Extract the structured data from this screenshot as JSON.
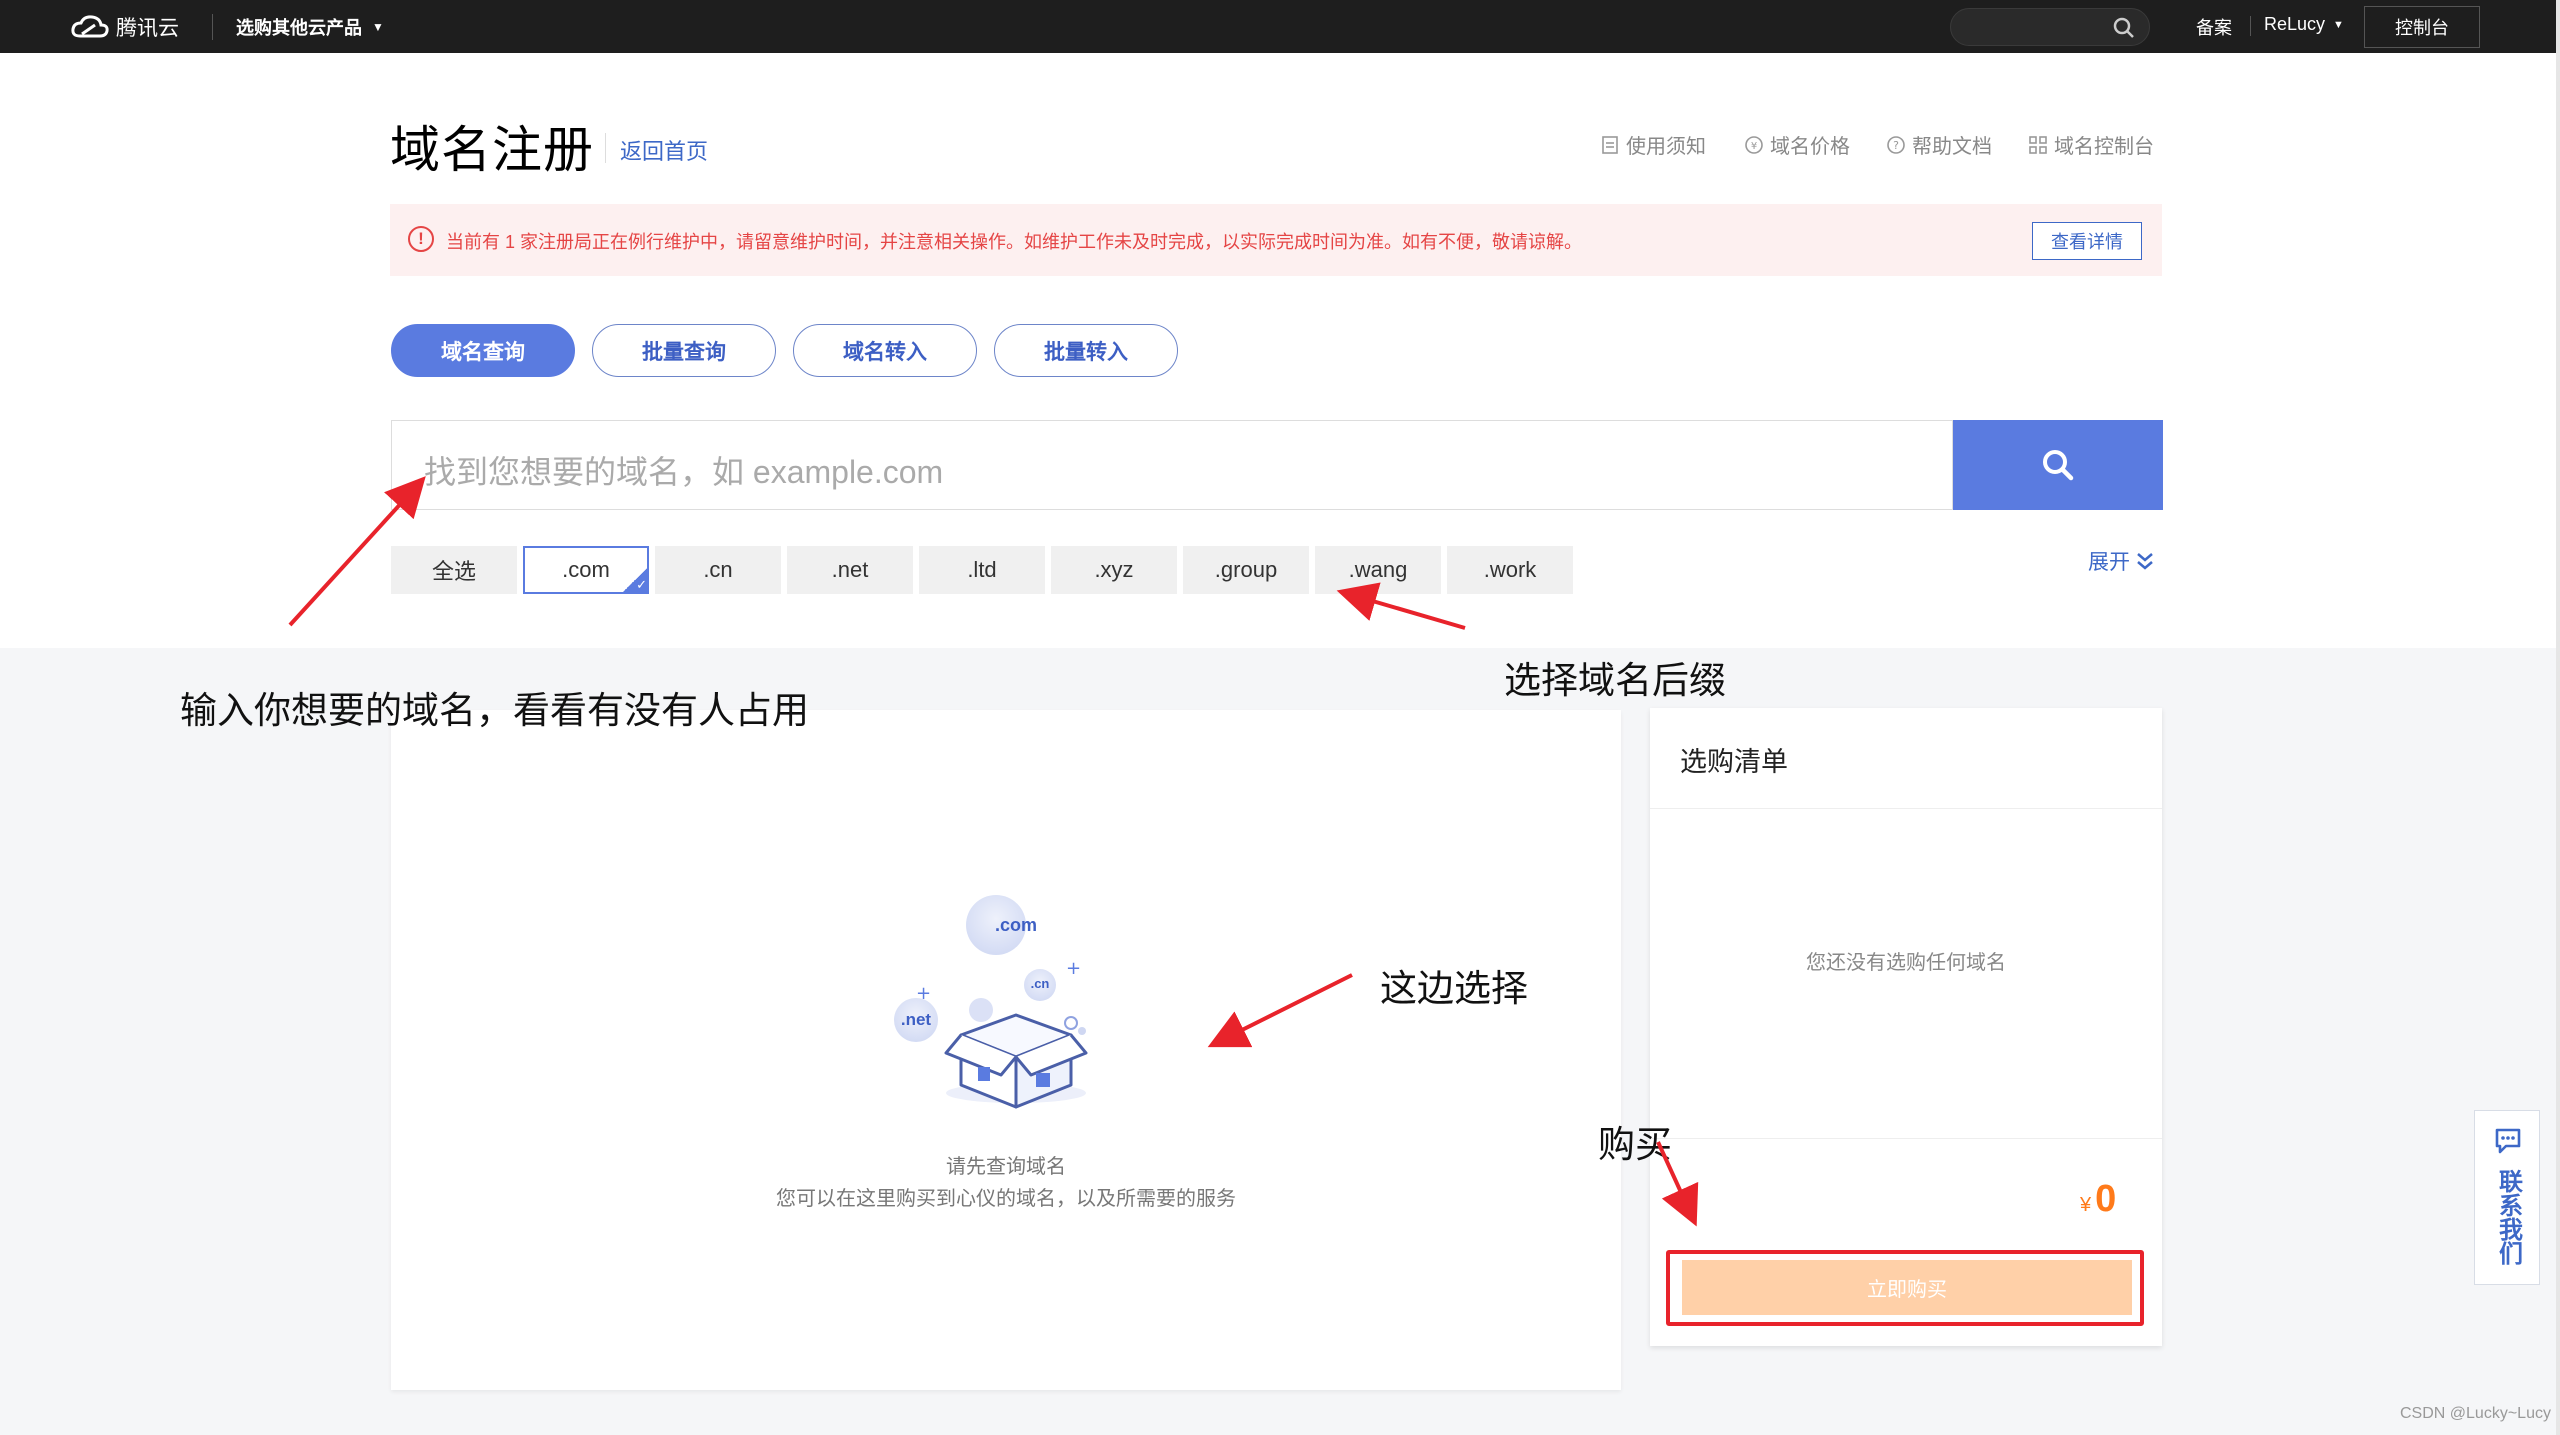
{
  "topbar": {
    "logo_text": "腾讯云",
    "products_label": "选购其他云产品",
    "beian_label": "备案",
    "user_label": "ReLucy",
    "console_label": "控制台"
  },
  "header": {
    "title": "域名注册",
    "back_label": "返回首页",
    "help_links": [
      "使用须知",
      "域名价格",
      "帮助文档",
      "域名控制台"
    ]
  },
  "notice": {
    "text": "当前有 1 家注册局正在例行维护中，请留意维护时间，并注意相关操作。如维护工作未及时完成，以实际完成时间为准。如有不便，敬请谅解。",
    "button_label": "查看详情"
  },
  "tabs": [
    {
      "label": "域名查询",
      "active": true
    },
    {
      "label": "批量查询",
      "active": false
    },
    {
      "label": "域名转入",
      "active": false
    },
    {
      "label": "批量转入",
      "active": false
    }
  ],
  "search": {
    "placeholder": "找到您想要的域名，如 example.com"
  },
  "suffixes": [
    {
      "label": "全选",
      "selected": false
    },
    {
      "label": ".com",
      "selected": true
    },
    {
      "label": ".cn",
      "selected": false
    },
    {
      "label": ".net",
      "selected": false
    },
    {
      "label": ".ltd",
      "selected": false
    },
    {
      "label": ".xyz",
      "selected": false
    },
    {
      "label": ".group",
      "selected": false
    },
    {
      "label": ".wang",
      "selected": false
    },
    {
      "label": ".work",
      "selected": false
    }
  ],
  "expand_label": "展开",
  "empty_state": {
    "line1": "请先查询域名",
    "line2": "您可以在这里购买到心仪的域名，以及所需要的服务",
    "bubble_com": ".com",
    "bubble_cn": ".cn",
    "bubble_net": ".net"
  },
  "cart": {
    "title": "选购清单",
    "empty_text": "您还没有选购任何域名",
    "currency": "¥",
    "total": "0",
    "buy_label": "立即购买"
  },
  "annotations": {
    "input_hint": "输入你想要的域名，看看有没有人占用",
    "suffix_hint": "选择域名后缀",
    "select_hint": "这边选择",
    "buy_hint": "购买"
  },
  "contact_label": "联系我们",
  "watermark": "CSDN @Lucky~Lucy",
  "colors": {
    "primary": "#5a7be0",
    "link": "#3d68c7",
    "alert": "#e54545",
    "price": "#ff7a1a",
    "buy_button": "#ffd0a8",
    "annotation_red": "#e8232b"
  }
}
